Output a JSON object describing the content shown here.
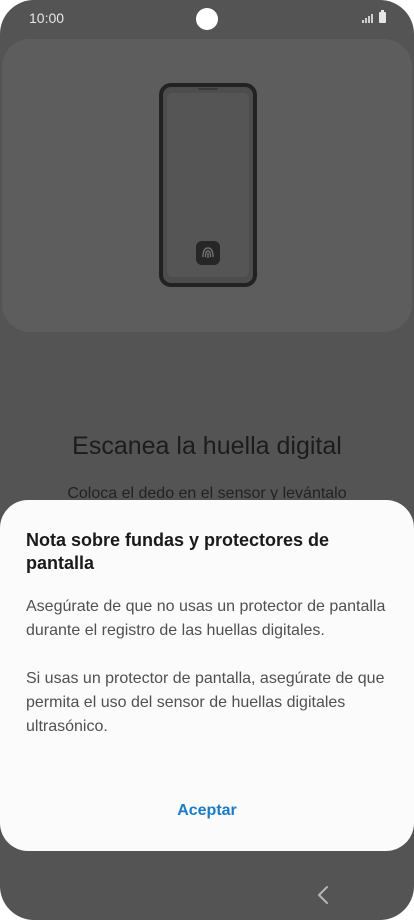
{
  "status_bar": {
    "time": "10:00"
  },
  "background": {
    "title": "Escanea la huella digital",
    "subtitle": "Coloca el dedo en el sensor y levántalo"
  },
  "dialog": {
    "title": "Nota sobre fundas y protectores de pantalla",
    "paragraphs": [
      "Asegúrate de que no usas un protector de pantalla durante el registro de las huellas digitales.",
      "Si usas un protector de pantalla, asegúrate de que permita el uso del sensor de huellas digitales ultrasónico."
    ],
    "accept_label": "Aceptar"
  },
  "colors": {
    "dim_background": "#545454",
    "dialog_background": "#fbfbfb",
    "accent": "#1c7bc4"
  },
  "icons": [
    "phone-illustration-icon",
    "fingerprint-icon",
    "signal-icon",
    "battery-icon",
    "back-icon"
  ]
}
